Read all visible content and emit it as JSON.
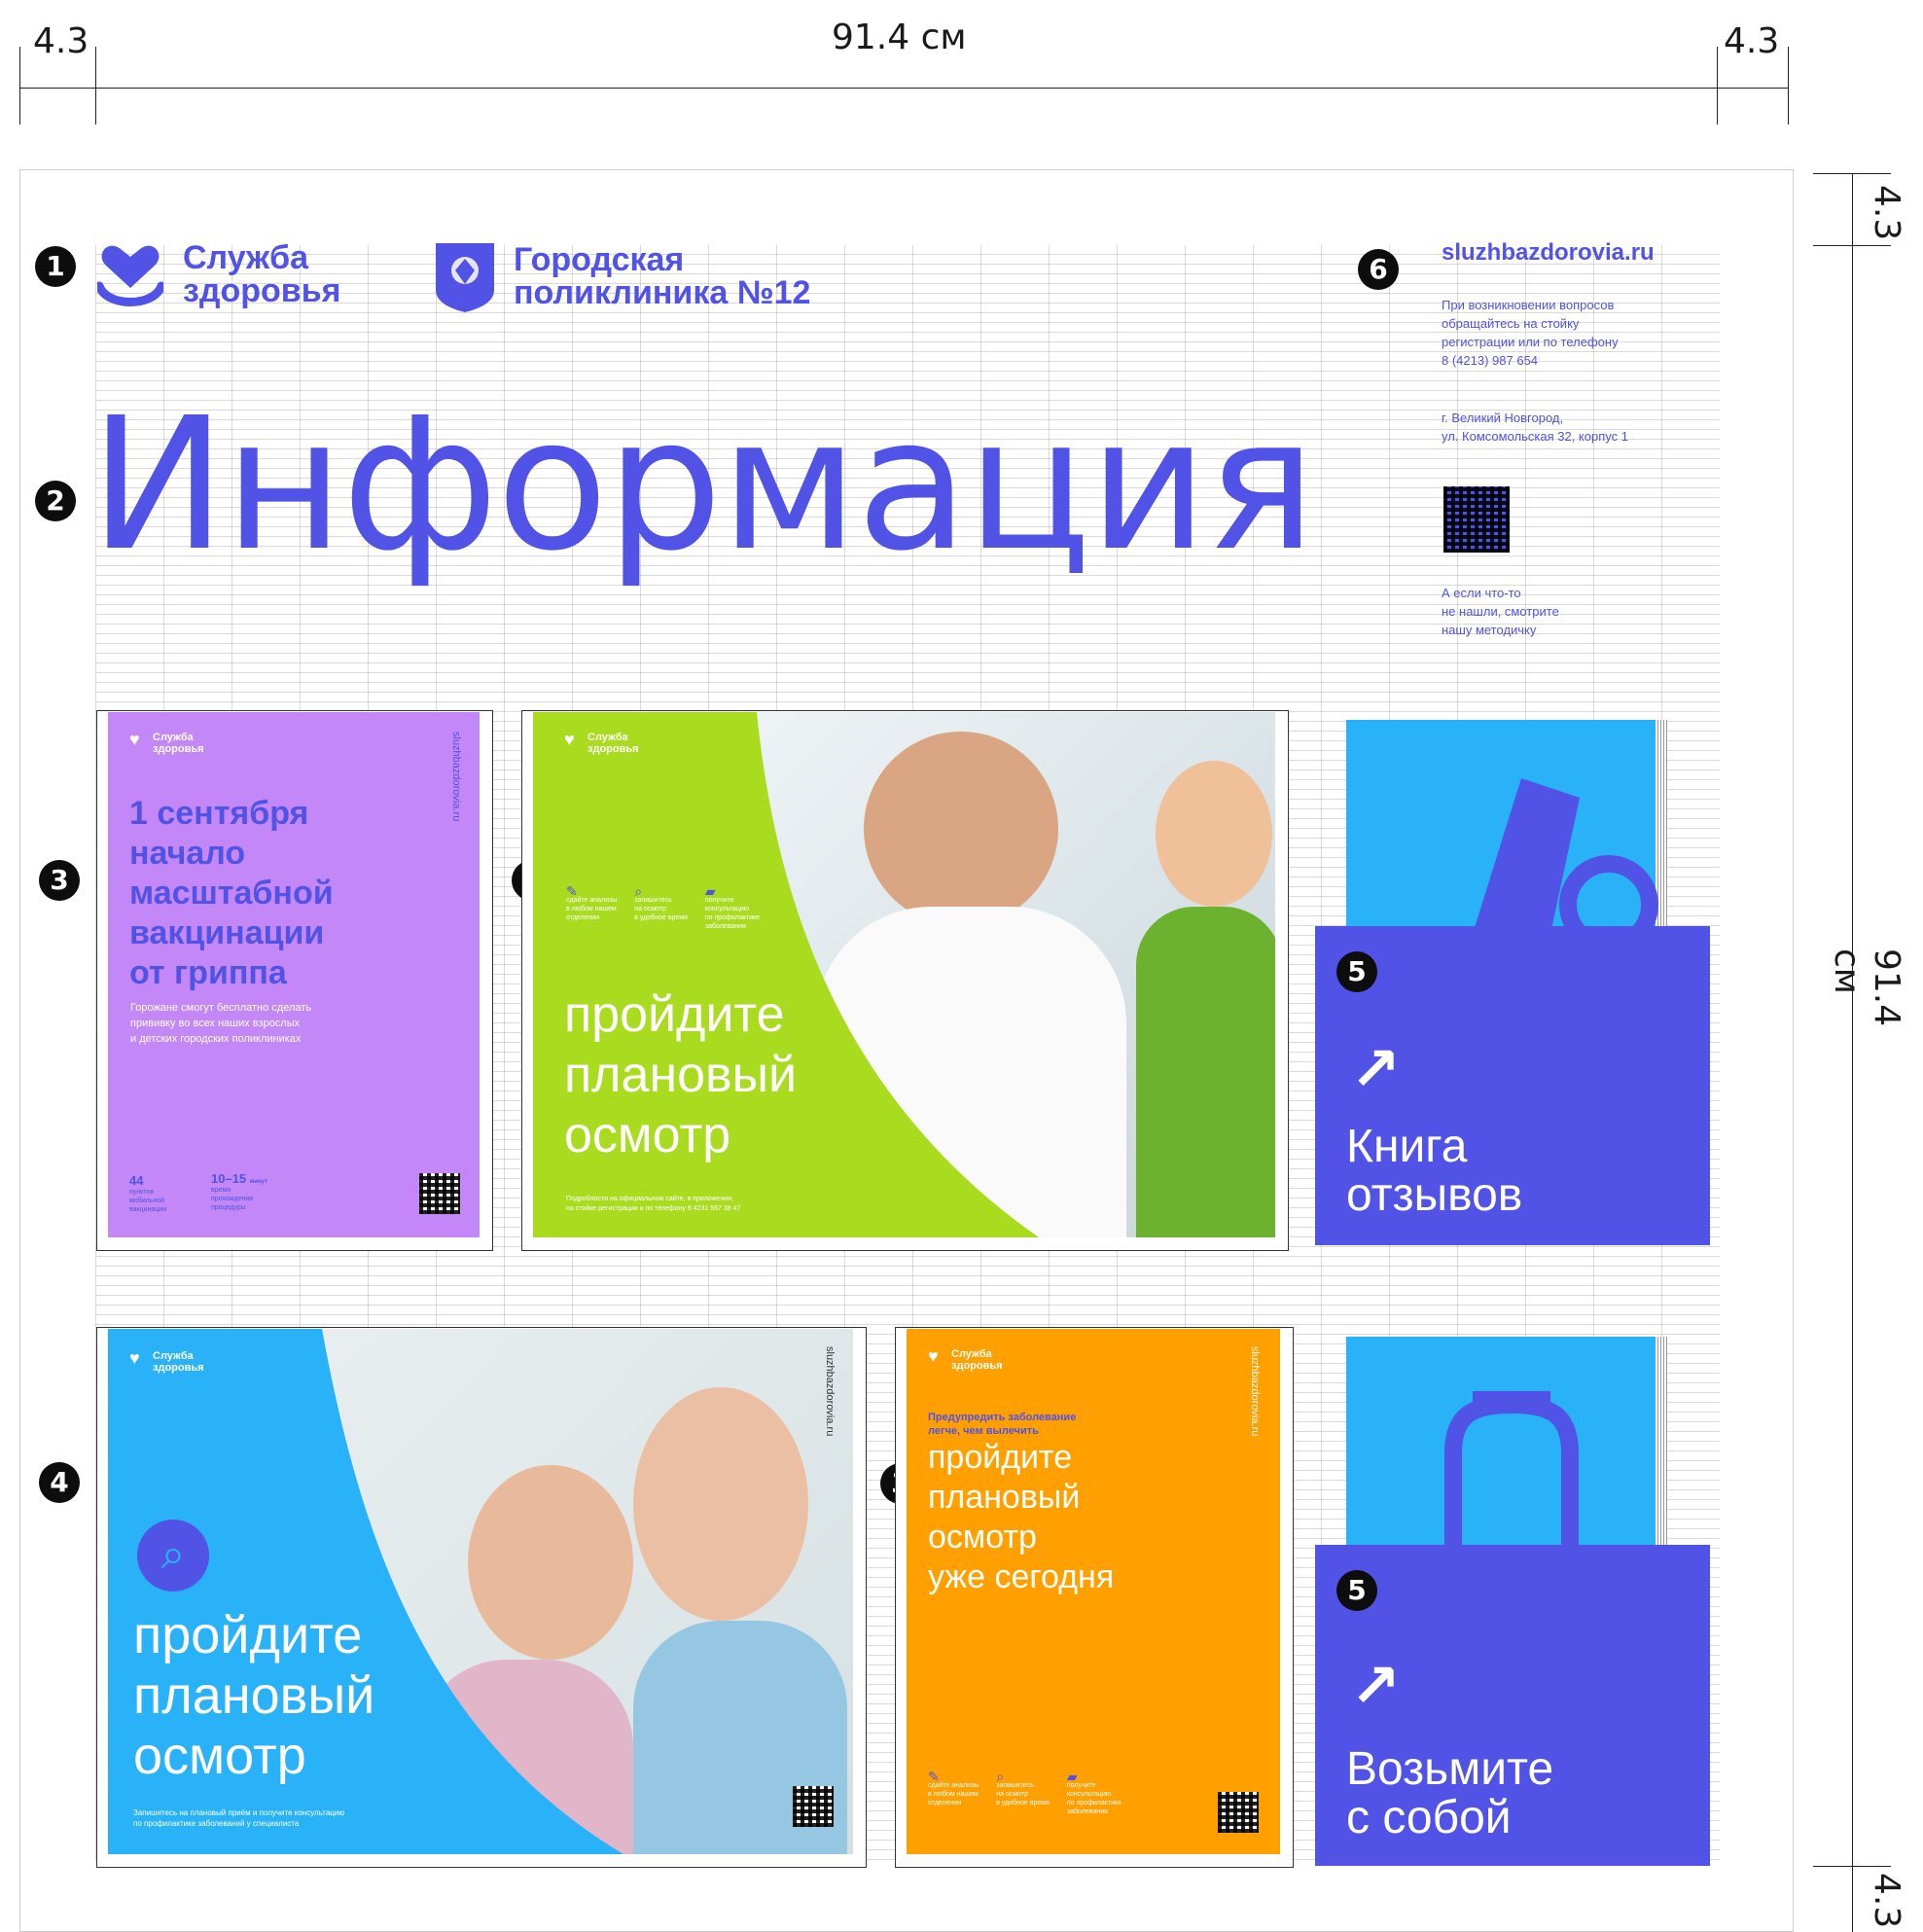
{
  "dimensions": {
    "side_margin": "4.3",
    "width": "91.4 см",
    "height": "91.4 см",
    "top_margin": "4.3",
    "bottom_margin": "4.3"
  },
  "header": {
    "logo_line1": "Служба",
    "logo_line2": "здоровья",
    "clinic_line1": "Городская",
    "clinic_line2": "поликлиника №12",
    "title": "Информация"
  },
  "sidebar": {
    "url": "sluzhbazdorovia.ru",
    "contact_line1": "При возникновении вопросов",
    "contact_line2": "обращайтесь на стойку",
    "contact_line3": "регистрации или по телефону",
    "contact_line4": "8 (4213) 987 654",
    "address_line1": "г. Великий Новгород,",
    "address_line2": "ул. Комсомольская 32, корпус 1",
    "note_line1": "А если что-то",
    "note_line2": "не нашли, смотрите",
    "note_line3": "нашу методичку"
  },
  "markers": [
    "1",
    "2",
    "3",
    "4",
    "5",
    "6"
  ],
  "poster_purple": {
    "logo_line1": "Служба",
    "logo_line2": "здоровья",
    "headline": [
      "1 сентября",
      "начало",
      "масштабной",
      "вакцинации",
      "от гриппа"
    ],
    "body_line1": "Горожане смогут бесплатно сделать",
    "body_line2": "прививку во всех наших взрослых",
    "body_line3": "и детских городских поликлиниках",
    "stat1_value": "44",
    "stat1_label": [
      "пунктов",
      "мобильной",
      "вакцинации"
    ],
    "stat2_value": "10–15",
    "stat2_unit": "минут",
    "stat2_label": [
      "время",
      "прохождения",
      "процедуры"
    ],
    "side_url": "sluzhbazdorovia.ru",
    "color": "#c387f7"
  },
  "poster_green": {
    "logo_line1": "Служба",
    "logo_line2": "здоровья",
    "icons": [
      {
        "icon": "test-tube-icon",
        "label": [
          "сдайте анализы",
          "в любом нашем",
          "отделении"
        ]
      },
      {
        "icon": "search-icon",
        "label": [
          "запишитесь",
          "на осмотр",
          "в удобное время"
        ]
      },
      {
        "icon": "chat-icon",
        "label": [
          "получите",
          "консультацию",
          "по профилактике",
          "заболевания"
        ]
      }
    ],
    "headline": [
      "пройдите",
      "плановый",
      "осмотр"
    ],
    "footer_line1": "Подробности на официальном сайте, в приложении,",
    "footer_line2": "на стойке регистрации и по телефону 8 4231 567 38 47",
    "color": "#a9dc1f"
  },
  "box_top": {
    "marker": "5",
    "title_line1": "Книга",
    "title_line2": "отзывов",
    "color_front": "#5152e6",
    "color_back": "#29b2f8"
  },
  "poster_blue": {
    "logo_line1": "Служба",
    "logo_line2": "здоровья",
    "headline": [
      "пройдите",
      "плановый",
      "осмотр"
    ],
    "body_line1": "Запишитесь на плановый приём и получите консультацию",
    "body_line2": "по профилактике заболеваний у специалиста",
    "side_url": "sluzhbazdorovia.ru",
    "color": "#29b2f8"
  },
  "poster_orange": {
    "logo_line1": "Служба",
    "logo_line2": "здоровья",
    "kicker_line1": "Предупредить заболевание",
    "kicker_line2": "легче, чем вылечить",
    "headline": [
      "пройдите",
      "плановый",
      "осмотр",
      "уже сегодня"
    ],
    "icons": [
      {
        "icon": "test-tube-icon",
        "label": [
          "сдайте анализы",
          "в любом нашем",
          "отделении"
        ]
      },
      {
        "icon": "search-icon",
        "label": [
          "запишитесь",
          "на осмотр",
          "в удобное время"
        ]
      },
      {
        "icon": "chat-icon",
        "label": [
          "получите",
          "консультацию",
          "по профилактике",
          "заболевания"
        ]
      }
    ],
    "side_url": "sluzhbazdorovia.ru",
    "color": "#ffa000"
  },
  "box_bottom": {
    "marker": "5",
    "title_line1": "Возьмите",
    "title_line2": "с собой",
    "color_front": "#5152e6",
    "color_back": "#29b2f8"
  }
}
